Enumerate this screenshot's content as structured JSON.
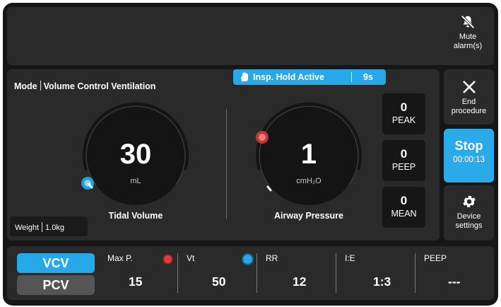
{
  "topbar": {
    "mute_label": "Mute alarm(s)"
  },
  "mode": {
    "label": "Mode",
    "value": "Volume Control Ventilation"
  },
  "hold_banner": {
    "label": "Insp. Hold Active",
    "seconds": "9s"
  },
  "tidal_volume": {
    "value": "30",
    "unit": "mL",
    "label": "Tidal Volume"
  },
  "airway_pressure": {
    "value": "1",
    "unit": "cmH₂O",
    "label": "Airway Pressure"
  },
  "weight": {
    "label": "Weight",
    "value": "1.0kg"
  },
  "stats": [
    {
      "value": "0",
      "label": "PEAK"
    },
    {
      "value": "0",
      "label": "PEEP"
    },
    {
      "value": "0",
      "label": "MEAN"
    }
  ],
  "side": {
    "end_label": "End procedure",
    "stop_label": "Stop",
    "stop_timer": "00:00:13",
    "settings_label": "Device settings"
  },
  "bottom": {
    "modes": [
      "VCV",
      "PCV"
    ],
    "params": [
      {
        "label": "Max P.",
        "value": "15"
      },
      {
        "label": "Vt",
        "value": "50"
      },
      {
        "label": "RR",
        "value": "12"
      },
      {
        "label": "I:E",
        "value": "1:3"
      },
      {
        "label": "PEEP",
        "value": "---"
      }
    ]
  },
  "colors": {
    "accent": "#27a8e8",
    "alarm_red": "#e23b3b",
    "panel": "#2a2a2a",
    "background": "#161616"
  }
}
